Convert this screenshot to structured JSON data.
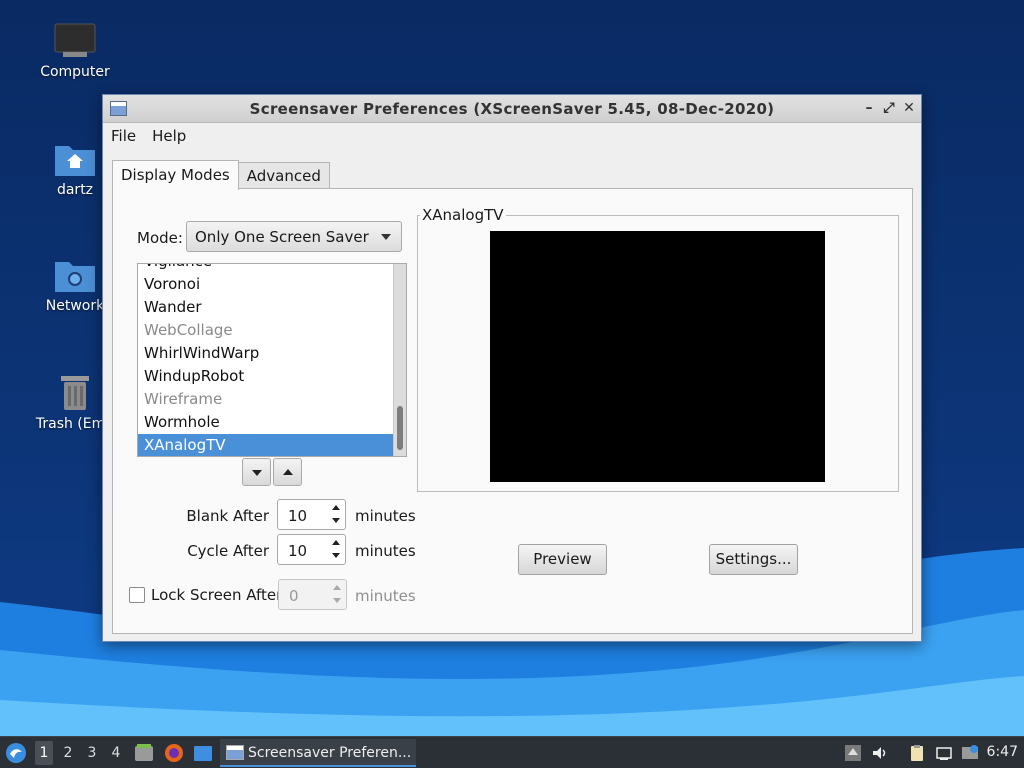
{
  "desktop": {
    "icons": [
      {
        "label": "Computer",
        "icon": "computer-icon"
      },
      {
        "label": "dartz",
        "icon": "home-folder-icon"
      },
      {
        "label": "Network",
        "icon": "network-folder-icon"
      },
      {
        "label": "Trash (Emp",
        "icon": "trash-icon"
      }
    ]
  },
  "window": {
    "title": "Screensaver Preferences  (XScreenSaver 5.45, 08-Dec-2020)",
    "controls": {
      "minimize": "–",
      "maximize": "⤢",
      "close": "✕"
    },
    "menu": [
      "File",
      "Help"
    ],
    "tabs": [
      "Display Modes",
      "Advanced"
    ],
    "mode": {
      "label": "Mode:",
      "value": "Only One Screen Saver"
    },
    "savers": [
      {
        "name": "Vigilance",
        "disabled": false
      },
      {
        "name": "Voronoi",
        "disabled": false
      },
      {
        "name": "Wander",
        "disabled": false
      },
      {
        "name": "WebCollage",
        "disabled": true
      },
      {
        "name": "WhirlWindWarp",
        "disabled": false
      },
      {
        "name": "WindupRobot",
        "disabled": false
      },
      {
        "name": "Wireframe",
        "disabled": true
      },
      {
        "name": "Wormhole",
        "disabled": false
      },
      {
        "name": "XAnalogTV",
        "disabled": false,
        "selected": true
      }
    ],
    "blank_after": {
      "label": "Blank After",
      "value": "10",
      "units": "minutes"
    },
    "cycle_after": {
      "label": "Cycle After",
      "value": "10",
      "units": "minutes"
    },
    "lock_screen": {
      "label": "Lock Screen After",
      "value": "0",
      "units": "minutes",
      "checked": false
    },
    "preview_title": "XAnalogTV",
    "preview_button": "Preview",
    "settings_button": "Settings..."
  },
  "taskbar": {
    "workspaces": [
      "1",
      "2",
      "3",
      "4"
    ],
    "active_workspace": "1",
    "task_label": "Screensaver Preferen...",
    "clock": "6:47"
  },
  "colors": {
    "selection": "#4a90d9",
    "desktop": "#0c3476",
    "taskbar": "#2b3036"
  }
}
